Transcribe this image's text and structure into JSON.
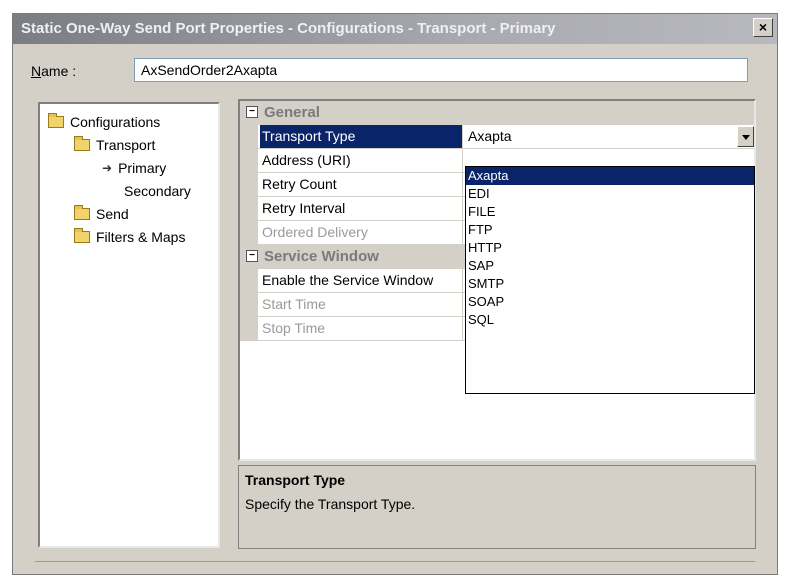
{
  "window": {
    "title": "Static One-Way Send Port Properties - Configurations - Transport - Primary",
    "close_symbol": "×"
  },
  "name_field": {
    "label_accel": "N",
    "label_rest": "ame :",
    "value": "AxSendOrder2Axapta"
  },
  "tree": {
    "items": [
      {
        "label": "Configurations",
        "icon": "folder-open-icon"
      },
      {
        "label": "Transport",
        "icon": "folder-open-icon"
      },
      {
        "label": "Primary",
        "icon": "arrow-icon"
      },
      {
        "label": "Secondary",
        "icon": ""
      },
      {
        "label": "Send",
        "icon": "folder-icon"
      },
      {
        "label": "Filters & Maps",
        "icon": "folder-icon"
      }
    ]
  },
  "grid": {
    "general_label": "General",
    "service_window_label": "Service Window",
    "props": {
      "transport_type": {
        "name": "Transport Type",
        "value": "Axapta"
      },
      "address": {
        "name": "Address (URI)"
      },
      "retry_count": {
        "name": "Retry Count"
      },
      "retry_interval": {
        "name": "Retry Interval"
      },
      "ordered_delivery": {
        "name": "Ordered Delivery"
      },
      "enable_service_window": {
        "name": "Enable the Service Window"
      },
      "start_time": {
        "name": "Start Time"
      },
      "stop_time": {
        "name": "Stop Time"
      }
    }
  },
  "dropdown": {
    "options": [
      "Axapta",
      "EDI",
      "FILE",
      "FTP",
      "HTTP",
      "SAP",
      "SMTP",
      "SOAP",
      "SQL"
    ],
    "selected": "Axapta"
  },
  "description": {
    "title": "Transport Type",
    "text": "Specify the Transport Type."
  }
}
